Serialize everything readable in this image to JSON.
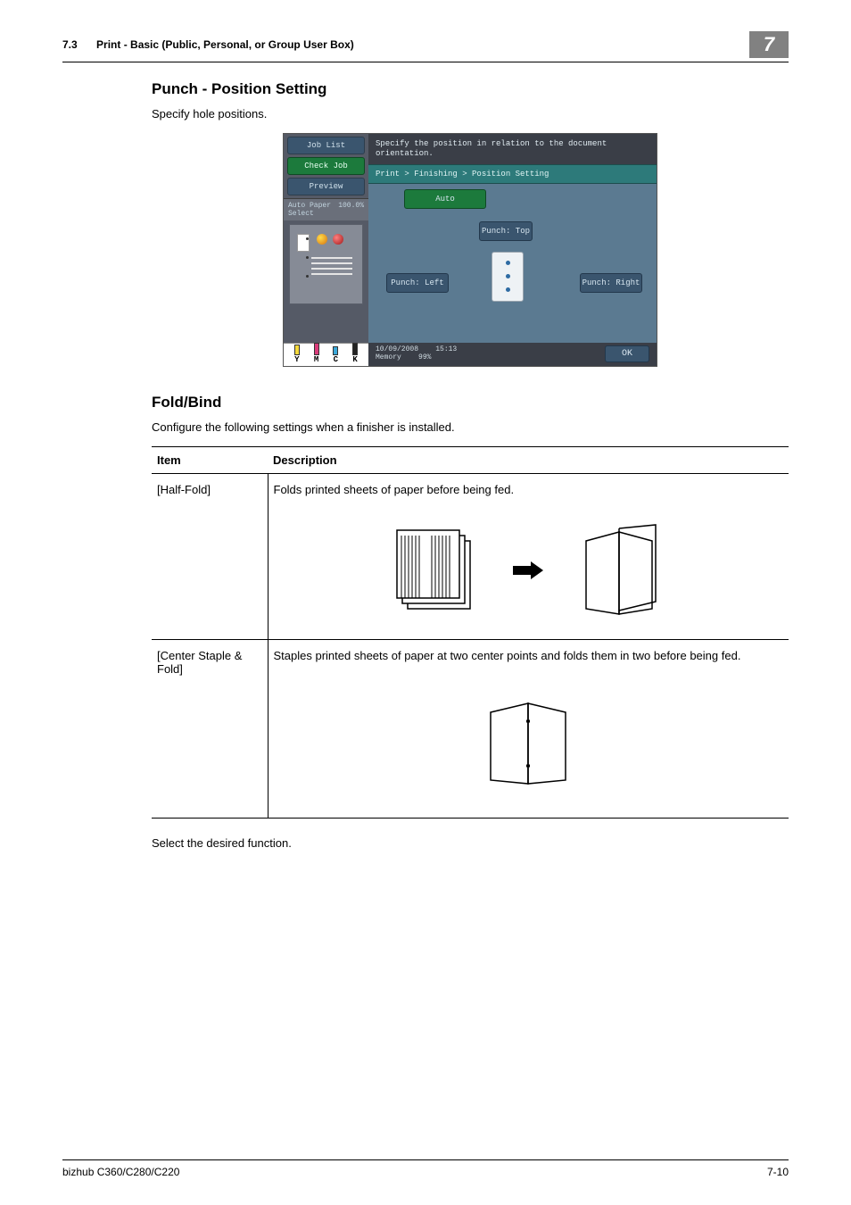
{
  "header": {
    "section_number": "7.3",
    "section_title": "Print - Basic (Public, Personal, or Group User Box)",
    "chapter": "7"
  },
  "section1": {
    "title": "Punch - Position Setting",
    "intro": "Specify hole positions."
  },
  "screenshot": {
    "left": {
      "job_list": "Job List",
      "check_job": "Check Job",
      "preview": "Preview",
      "paper_label": "Auto Paper Select",
      "paper_value": "100.0%"
    },
    "message": "Specify the position in relation to the document orientation.",
    "breadcrumb": "Print > Finishing > Position Setting",
    "options": {
      "auto": "Auto",
      "top": "Punch: Top",
      "left": "Punch: Left",
      "right": "Punch: Right"
    },
    "status": {
      "date": "10/09/2008",
      "time": "15:13",
      "memory_label": "Memory",
      "memory_value": "99%"
    },
    "ok": "OK",
    "toner": {
      "y": "Y",
      "m": "M",
      "c": "C",
      "k": "K"
    }
  },
  "section2": {
    "title": "Fold/Bind",
    "intro": "Configure the following settings when a finisher is installed.",
    "table": {
      "head_item": "Item",
      "head_desc": "Description",
      "rows": [
        {
          "item": "[Half-Fold]",
          "desc": "Folds printed sheets of paper before being fed."
        },
        {
          "item": "[Center Staple & Fold]",
          "desc": "Staples printed sheets of paper at two center points and folds them in two before being fed."
        }
      ]
    },
    "outro": "Select the desired function."
  },
  "footer": {
    "model": "bizhub C360/C280/C220",
    "page": "7-10"
  }
}
